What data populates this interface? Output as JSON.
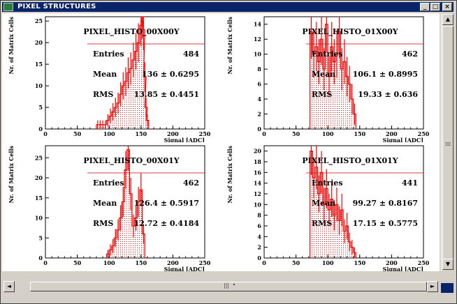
{
  "window": {
    "title": "PIXEL STRUCTURES",
    "controls": {
      "minimize": "_",
      "maximize": "□",
      "close": "×"
    }
  },
  "scrollbars": {
    "up_arrow": "▲",
    "down_arrow": "▼",
    "left_arrow": "◄",
    "right_arrow": "►",
    "grip": "|||"
  },
  "chart_data": [
    {
      "type": "bar",
      "title": "PIXEL_HISTO_00X00Y",
      "xlabel": "Signal [ADC]",
      "ylabel": "Nr. of Matrix Cells",
      "xlim": [
        0,
        250
      ],
      "ylim": [
        0,
        26
      ],
      "xticks": [
        "0",
        "50",
        "100",
        "150",
        "200",
        "250"
      ],
      "yticks": [
        "0",
        "5",
        "10",
        "15",
        "20",
        "25"
      ],
      "stats": [
        {
          "label": "Entries",
          "value": "484"
        },
        {
          "label": "Mean",
          "value": "136 ± 0.6295"
        },
        {
          "label": "RMS",
          "value": "13.85 ± 0.4451"
        }
      ],
      "x": [
        80,
        84,
        88,
        92,
        96,
        100,
        104,
        108,
        112,
        116,
        120,
        124,
        128,
        132,
        136,
        140,
        144,
        148,
        150,
        152,
        154,
        156,
        158
      ],
      "values": [
        1,
        1,
        1,
        1,
        2,
        3,
        4,
        5,
        6,
        8,
        10,
        11,
        13,
        14,
        16,
        18,
        20,
        24,
        26,
        23,
        12,
        5,
        2
      ]
    },
    {
      "type": "bar",
      "title": "PIXEL_HISTO_01X00Y",
      "xlabel": "Signal [ADC]",
      "ylabel": "Nr. of Matrix Cells",
      "xlim": [
        0,
        250
      ],
      "ylim": [
        0,
        15
      ],
      "xticks": [
        "0",
        "50",
        "100",
        "150",
        "200",
        "250"
      ],
      "yticks": [
        "0",
        "2",
        "4",
        "6",
        "8",
        "10",
        "12",
        "14"
      ],
      "stats": [
        {
          "label": "Entries",
          "value": "462"
        },
        {
          "label": "Mean",
          "value": "106.1 ± 0.8995"
        },
        {
          "label": "RMS",
          "value": "19.33 ± 0.636"
        }
      ],
      "x": [
        72,
        76,
        80,
        84,
        88,
        92,
        96,
        100,
        104,
        108,
        112,
        116,
        120,
        124,
        128,
        132,
        136,
        140
      ],
      "values": [
        13,
        10,
        11,
        9,
        12,
        8,
        14,
        7,
        11,
        9,
        10,
        13,
        8,
        9,
        7,
        6,
        4,
        2
      ]
    },
    {
      "type": "bar",
      "title": "PIXEL_HISTO_00X01Y",
      "xlabel": "Signal [ADC]",
      "ylabel": "Nr. of Matrix Cells",
      "xlim": [
        0,
        250
      ],
      "ylim": [
        0,
        28
      ],
      "xticks": [
        "0",
        "50",
        "100",
        "150",
        "200",
        "250"
      ],
      "yticks": [
        "0",
        "5",
        "10",
        "15",
        "20",
        "25"
      ],
      "stats": [
        {
          "label": "Entries",
          "value": "462"
        },
        {
          "label": "Mean",
          "value": "126.4 ± 0.5917"
        },
        {
          "label": "RMS",
          "value": "12.72 ± 0.4184"
        }
      ],
      "x": [
        96,
        100,
        104,
        108,
        112,
        116,
        120,
        124,
        128,
        132,
        136,
        140,
        144,
        148,
        152
      ],
      "values": [
        1,
        2,
        3,
        5,
        7,
        10,
        14,
        22,
        27,
        16,
        8,
        10,
        14,
        17,
        6
      ]
    },
    {
      "type": "bar",
      "title": "PIXEL_HISTO_01X01Y",
      "xlabel": "Signal [ADC]",
      "ylabel": "Nr. of Matrix Cells",
      "xlim": [
        0,
        250
      ],
      "ylim": [
        0,
        21
      ],
      "xticks": [
        "0",
        "50",
        "100",
        "150",
        "200",
        "250"
      ],
      "yticks": [
        "0",
        "2",
        "4",
        "6",
        "8",
        "10",
        "12",
        "14",
        "16",
        "18",
        "20"
      ],
      "stats": [
        {
          "label": "Entries",
          "value": "441"
        },
        {
          "label": "Mean",
          "value": "99.27 ± 0.8167"
        },
        {
          "label": "RMS",
          "value": "17.15 ± 0.5775"
        }
      ],
      "x": [
        72,
        76,
        80,
        84,
        88,
        92,
        96,
        100,
        104,
        108,
        112,
        116,
        120,
        124,
        128,
        132,
        136,
        140
      ],
      "values": [
        20,
        15,
        17,
        12,
        16,
        10,
        13,
        9,
        11,
        8,
        10,
        7,
        9,
        5,
        6,
        3,
        2,
        1
      ]
    }
  ],
  "colors": {
    "histogram": "#ff0000",
    "fill_dots": "#ff0000",
    "titlebar": "#0a246a",
    "status_box": "#0a246a"
  }
}
